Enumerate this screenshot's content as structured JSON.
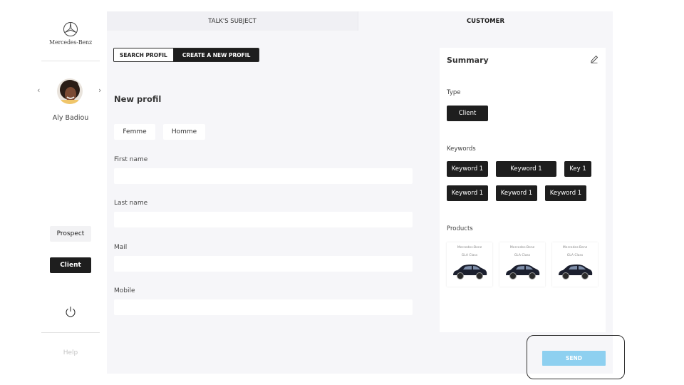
{
  "brand": {
    "name": "Mercedes-Benz",
    "icon": "mercedes-star-icon"
  },
  "user": {
    "name": "Aly Badiou",
    "prev_icon": "chevron-left-icon",
    "next_icon": "chevron-right-icon"
  },
  "sidebar": {
    "prospect_label": "Prospect",
    "client_label": "Client",
    "power_icon": "power-icon",
    "help_label": "Help"
  },
  "tabs": {
    "talk": "TALK'S SUBJECT",
    "customer": "CUSTOMER"
  },
  "mode": {
    "search_label": "SEARCH PROFIL",
    "create_label": "CREATE A NEW PROFIL"
  },
  "form": {
    "title": "New profil",
    "gender_female": "Femme",
    "gender_male": "Homme",
    "first_name_label": "First name",
    "first_name_value": "",
    "last_name_label": "Last name",
    "last_name_value": "",
    "mail_label": "Mail",
    "mail_value": "",
    "mobile_label": "Mobile",
    "mobile_value": ""
  },
  "summary": {
    "title": "Summary",
    "edit_icon": "pencil-icon",
    "type_label": "Type",
    "type_value": "Client",
    "keywords_label": "Keywords",
    "keywords": [
      "Keyword 1",
      "Keyword 1",
      "Key 1",
      "Keyword 1",
      "Keyword 1",
      "Keyword 1"
    ],
    "products_label": "Products",
    "products": [
      {
        "brand": "Mercedes-Benz",
        "model": "GLA Class"
      },
      {
        "brand": "Mercedes-Benz",
        "model": "GLA Class"
      },
      {
        "brand": "Mercedes-Benz",
        "model": "GLA Class"
      }
    ]
  },
  "send_label": "SEND",
  "colors": {
    "dark": "#1e1e1e",
    "panel": "#f6f6f9",
    "send": "#8ed0f0"
  }
}
